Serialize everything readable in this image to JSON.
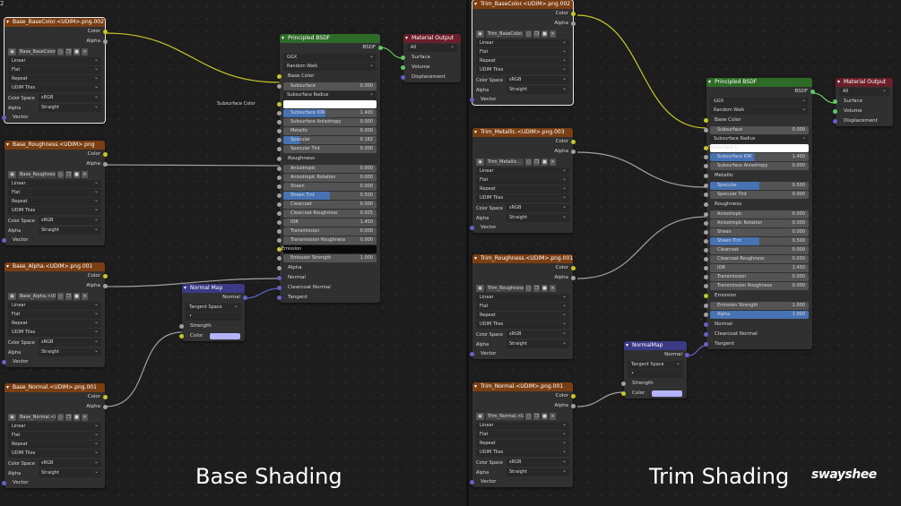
{
  "corner_text": "2",
  "captions": {
    "left": "Base Shading",
    "right": "Trim Shading"
  },
  "logo": "swayshee",
  "common": {
    "linear": "Linear",
    "flat": "Flat",
    "repeat": "Repeat",
    "udim": "UDIM Tiles",
    "colorspace_label": "Color Space",
    "srgb": "sRGB",
    "alpha_label": "Alpha",
    "straight": "Straight",
    "vector": "Vector",
    "color": "Color",
    "alpha": "Alpha"
  },
  "left_textures": [
    {
      "title": "Base_BaseColor.<UDIM>.png.002",
      "image": "Base_BaseColor..."
    },
    {
      "title": "Base_Roughness.<UDIM>.png",
      "image": "Base_Roughness..."
    },
    {
      "title": "Base_Alpha.<UDIM>.png.001",
      "image": "Base_Alpha.<UDI..."
    },
    {
      "title": "Base_Normal.<UDIM>.png.001",
      "image": "Base_Normal.<U..."
    }
  ],
  "right_textures": [
    {
      "title": "Trim_BaseColor.<UDIM>.png.002",
      "image": "Trim_BaseColor..."
    },
    {
      "title": "Trim_Metallic.<UDIM>.png.003",
      "image": "Trim_Metallic..."
    },
    {
      "title": "Trim_Roughness.<UDIM>.png.001",
      "image": "Trim_Roughness..."
    },
    {
      "title": "Trim_Normal.<UDIM>.png.001",
      "image": "Trim_Normal.<U..."
    }
  ],
  "bsdf": {
    "title": "Principled BSDF",
    "out": "BSDF",
    "dist": "GGX",
    "sss": "Random Walk",
    "base_color": "Base Color",
    "subsurface": "Subsurface",
    "subsurface_radius": "Subsurface Radius",
    "subsurface_color": "Subsurface Color",
    "subsurface_color_short": "Subsurface C...",
    "subsurface_ior": "Subsurface IOR",
    "subsurface_aniso": "Subsurface Anisotropy",
    "metallic": "Metallic",
    "specular": "Specular",
    "specular_tint": "Specular Tint",
    "roughness": "Roughness",
    "anisotropic": "Anisotropic",
    "aniso_rot": "Anisotropic Rotation",
    "sheen": "Sheen",
    "sheen_tint": "Sheen Tint",
    "clearcoat": "Clearcoat",
    "clearcoat_rough": "Clearcoat Roughness",
    "ior": "IOR",
    "transmission": "Transmission",
    "trans_rough": "Transmission Roughness",
    "emission": "Emission",
    "emission_strength": "Emission Strength",
    "alpha": "Alpha",
    "normal": "Normal",
    "clearcoat_normal": "Clearcoat Normal",
    "tangent": "Tangent",
    "left_vals": {
      "subsurface": "0.000",
      "sss_ior": "1.400",
      "sss_aniso": "0.000",
      "metallic": "0.000",
      "specular": "0.182",
      "spec_tint": "0.000",
      "aniso": "0.000",
      "aniso_rot": "0.000",
      "sheen": "0.000",
      "sheen_tint": "0.500",
      "clearcoat": "0.000",
      "cc_rough": "0.025",
      "ior": "1.450",
      "transmission": "0.000",
      "trans_rough": "0.000",
      "emission_strength": "1.000"
    },
    "right_vals": {
      "subsurface": "0.000",
      "sss_ior": "1.400",
      "sss_aniso": "0.000",
      "specular": "0.500",
      "spec_tint": "0.000",
      "aniso": "0.000",
      "aniso_rot": "0.000",
      "sheen": "0.000",
      "sheen_tint": "0.500",
      "clearcoat": "0.000",
      "cc_rough": "0.030",
      "ior": "1.450",
      "transmission": "0.000",
      "trans_rough": "0.000",
      "emission_strength": "1.000",
      "alpha": "1.000"
    }
  },
  "output": {
    "title": "Material Output",
    "target": "All",
    "surface": "Surface",
    "volume": "Volume",
    "displacement": "Displacement"
  },
  "normal_map": {
    "title_left": "Normal Map",
    "title_right": "NormalMap",
    "normal": "Normal",
    "space": "Tangent Space",
    "uv": "•",
    "strength": "Strength",
    "color": "Color"
  },
  "colors": {
    "wire_yellow": "#c7c729",
    "wire_grey": "#a1a1a1",
    "wire_purple": "#6363c7",
    "wire_green": "#63c763",
    "normal_color": "#b3b3ff"
  }
}
